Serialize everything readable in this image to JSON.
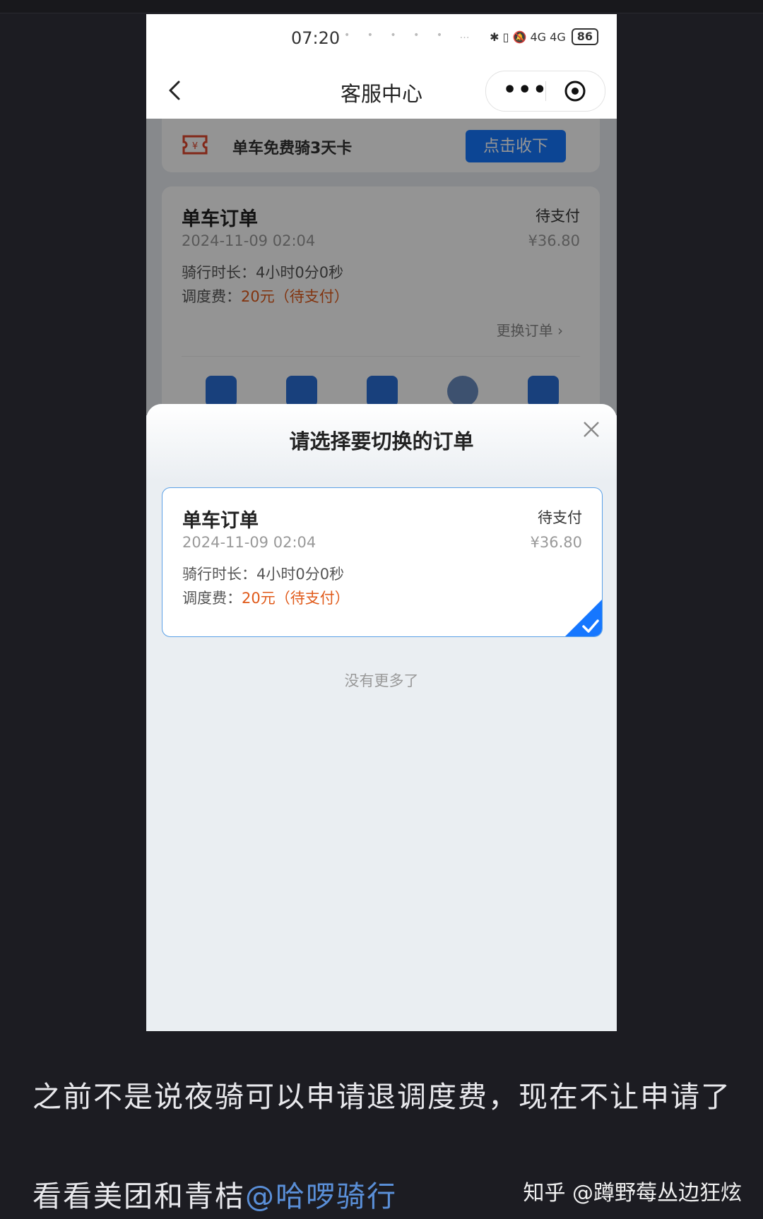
{
  "status_bar": {
    "time": "07:20",
    "dots": "• • • • • …",
    "signal": "✱ ▯ 🔕 4G 4G",
    "battery": "86"
  },
  "nav": {
    "title": "客服中心",
    "more": "•••"
  },
  "coupon": {
    "text": "单车免费骑3天卡",
    "button": "点击收下"
  },
  "background_order": {
    "title": "单车订单",
    "status": "待支付",
    "date": "2024-11-09 02:04",
    "price": "¥36.80",
    "duration_label": "骑行时长：",
    "duration_value": "4小时0分0秒",
    "fee_label": "调度费：",
    "fee_value": "20元（待支付）",
    "switch": "更换订单 ›"
  },
  "sheet": {
    "title": "请选择要切换的订单",
    "no_more": "没有更多了",
    "order": {
      "title": "单车订单",
      "status": "待支付",
      "date": "2024-11-09 02:04",
      "price": "¥36.80",
      "duration_label": "骑行时长：",
      "duration_value": "4小时0分0秒",
      "fee_label": "调度费：",
      "fee_value": "20元（待支付）"
    }
  },
  "caption": {
    "line1": "之前不是说夜骑可以申请退调度费，现在不让申请了",
    "line2_prefix": "看看美团和青桔",
    "line2_mention": "@哈啰骑行"
  },
  "watermark": "知乎 @蹲野莓丛边狂炫",
  "colors": {
    "accent": "#1677ff",
    "fee": "#e05a1a",
    "mention": "#5a8fd8"
  }
}
